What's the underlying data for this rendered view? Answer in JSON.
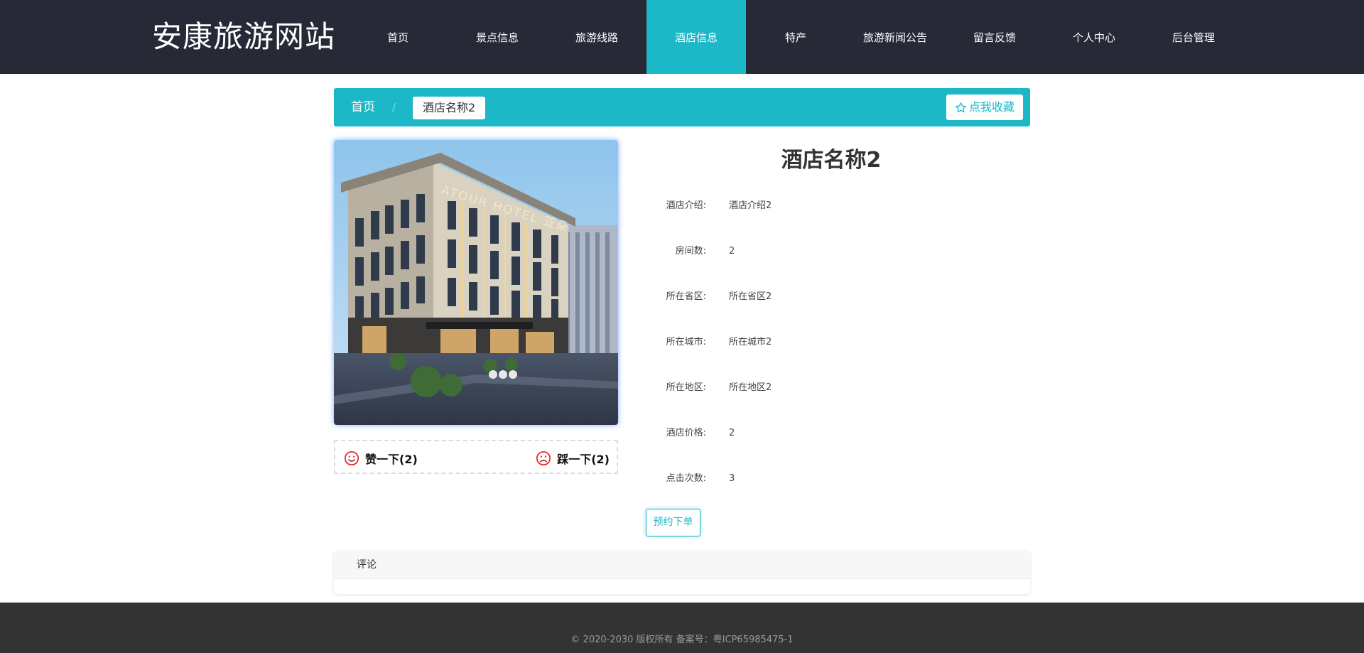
{
  "header": {
    "logo": "安康旅游网站",
    "nav": [
      {
        "label": "首页",
        "active": false
      },
      {
        "label": "景点信息",
        "active": false
      },
      {
        "label": "旅游线路",
        "active": false
      },
      {
        "label": "酒店信息",
        "active": true
      },
      {
        "label": "特产",
        "active": false
      },
      {
        "label": "旅游新闻公告",
        "active": false
      },
      {
        "label": "留言反馈",
        "active": false
      },
      {
        "label": "个人中心",
        "active": false
      },
      {
        "label": "后台管理",
        "active": false
      }
    ]
  },
  "breadcrumb": {
    "home": "首页",
    "separator": "/",
    "current": "酒店名称2",
    "favorite_label": "点我收藏"
  },
  "votes": {
    "like_label": "赞一下(2)",
    "dislike_label": "踩一下(2)"
  },
  "hotel": {
    "name": "酒店名称2",
    "image_sign": "ATOUR HOTEL 亚朵",
    "fields": [
      {
        "label": "酒店介绍:",
        "value": "酒店介绍2"
      },
      {
        "label": "房间数:",
        "value": "2"
      },
      {
        "label": "所在省区:",
        "value": "所在省区2"
      },
      {
        "label": "所在城市:",
        "value": "所在城市2"
      },
      {
        "label": "所在地区:",
        "value": "所在地区2"
      },
      {
        "label": "酒店价格:",
        "value": "2"
      },
      {
        "label": "点击次数:",
        "value": "3"
      }
    ]
  },
  "order_button": "预约下单",
  "comments": {
    "title": "评论"
  },
  "footer": {
    "copyright": "© 2020-2030 版权所有 备案号：粤ICP65985475-1"
  },
  "colors": {
    "header_bg": "#272a36",
    "accent": "#1cb8c8",
    "footer_bg": "#333333",
    "vote_icon": "#e02020"
  }
}
